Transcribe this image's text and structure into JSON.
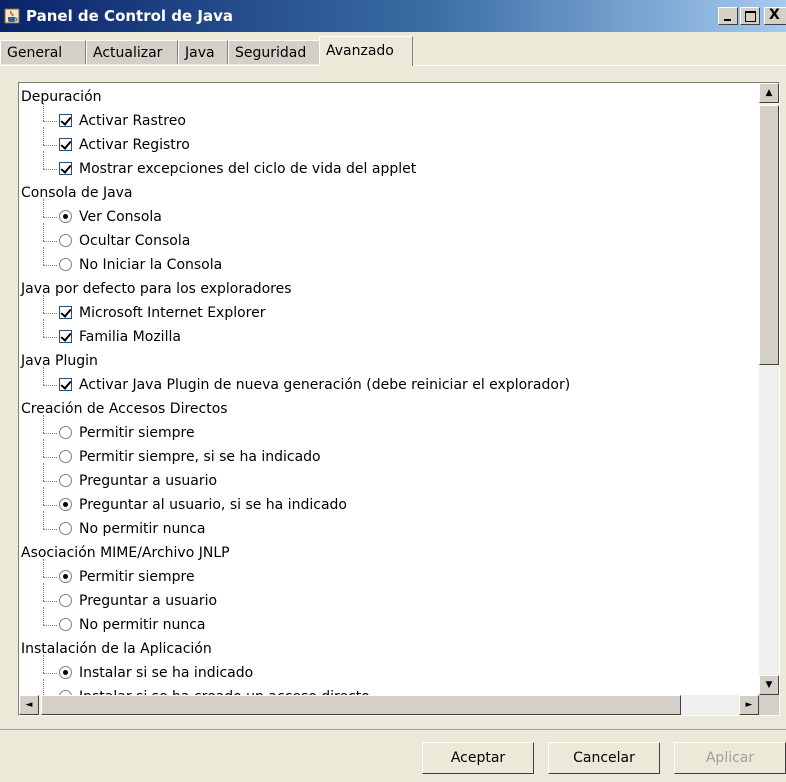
{
  "window": {
    "title": "Panel de Control de Java",
    "icon": "java-cup-icon",
    "close_glyph": "X"
  },
  "tabs": [
    {
      "label": "General",
      "active": false
    },
    {
      "label": "Actualizar",
      "active": false
    },
    {
      "label": "Java",
      "active": false
    },
    {
      "label": "Seguridad",
      "active": false
    },
    {
      "label": "Avanzado",
      "active": true
    }
  ],
  "tree": [
    {
      "group": "Depuración",
      "items": [
        {
          "type": "checkbox",
          "label": "Activar Rastreo",
          "checked": true
        },
        {
          "type": "checkbox",
          "label": "Activar Registro",
          "checked": true
        },
        {
          "type": "checkbox",
          "label": "Mostrar excepciones del ciclo de vida del applet",
          "checked": true
        }
      ]
    },
    {
      "group": "Consola de Java",
      "items": [
        {
          "type": "radio",
          "label": "Ver Consola",
          "checked": true
        },
        {
          "type": "radio",
          "label": "Ocultar Consola",
          "checked": false
        },
        {
          "type": "radio",
          "label": "No Iniciar la Consola",
          "checked": false
        }
      ]
    },
    {
      "group": "Java por defecto para los exploradores",
      "items": [
        {
          "type": "checkbox",
          "label": "Microsoft Internet Explorer",
          "checked": true
        },
        {
          "type": "checkbox",
          "label": "Familia Mozilla",
          "checked": true
        }
      ]
    },
    {
      "group": "Java Plugin",
      "items": [
        {
          "type": "checkbox",
          "label": "Activar Java Plugin de nueva generación (debe reiniciar el explorador)",
          "checked": true
        }
      ]
    },
    {
      "group": "Creación de Accesos Directos",
      "items": [
        {
          "type": "radio",
          "label": "Permitir siempre",
          "checked": false
        },
        {
          "type": "radio",
          "label": "Permitir siempre, si se ha indicado",
          "checked": false
        },
        {
          "type": "radio",
          "label": "Preguntar a usuario",
          "checked": false
        },
        {
          "type": "radio",
          "label": "Preguntar al usuario, si se ha indicado",
          "checked": true
        },
        {
          "type": "radio",
          "label": "No permitir nunca",
          "checked": false
        }
      ]
    },
    {
      "group": "Asociación MIME/Archivo JNLP",
      "items": [
        {
          "type": "radio",
          "label": "Permitir siempre",
          "checked": true
        },
        {
          "type": "radio",
          "label": "Preguntar a usuario",
          "checked": false
        },
        {
          "type": "radio",
          "label": "No permitir nunca",
          "checked": false
        }
      ]
    },
    {
      "group": "Instalación de la Aplicación",
      "items": [
        {
          "type": "radio",
          "label": "Instalar si se ha indicado",
          "checked": true
        },
        {
          "type": "radio",
          "label": "Instalar si se ha creado un acceso directo",
          "checked": false
        }
      ]
    }
  ],
  "scrollbar": {
    "up_glyph": "▲",
    "down_glyph": "▼",
    "left_glyph": "◄",
    "right_glyph": "►"
  },
  "buttons": {
    "ok_label": "Aceptar",
    "cancel_label": "Cancelar",
    "apply_label": "Aplicar",
    "apply_enabled": false
  }
}
